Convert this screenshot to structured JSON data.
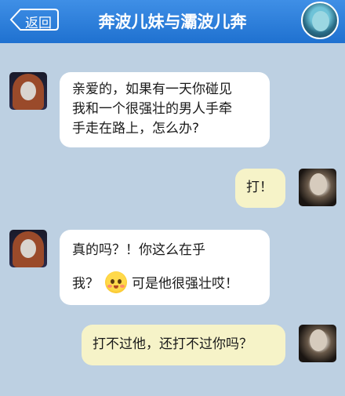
{
  "header": {
    "back_label": "返回",
    "title": "奔波儿妹与灞波儿奔"
  },
  "messages": [
    {
      "side": "left",
      "lines": [
        "亲爱的，如果有一天你碰见",
        "我和一个很强壮的男人手牵",
        "手走在路上，怎么办?"
      ]
    },
    {
      "side": "right",
      "lines": [
        "打！"
      ]
    },
    {
      "side": "left",
      "lines": [
        "真的吗？！你这么在乎",
        "我？",
        "可是他很强壮哎！"
      ],
      "emoji": "flushed-face-icon"
    },
    {
      "side": "right",
      "lines": [
        "打不过他，还打不过你吗？"
      ]
    }
  ]
}
